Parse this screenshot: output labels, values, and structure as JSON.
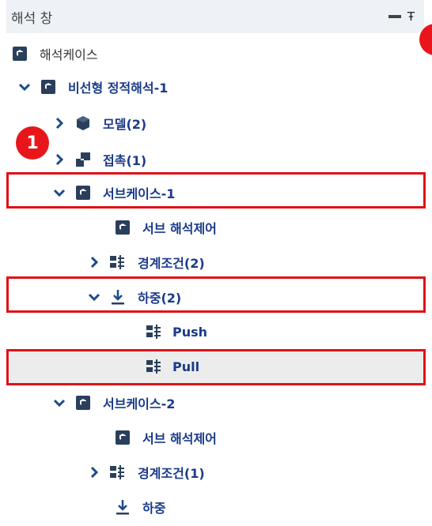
{
  "header": {
    "title": "해석 창",
    "minimize_icon": "minimize-icon",
    "pin_icon": "pin-icon",
    "pin_glyph": "Ŧ"
  },
  "badge": {
    "number": "1"
  },
  "tree": {
    "root": {
      "label": "해석케이스"
    },
    "case": {
      "label": "비선형 정적해석-1"
    },
    "model": {
      "label": "모델(2)"
    },
    "contact": {
      "label": "접촉(1)"
    },
    "subcase1": {
      "label": "서브케이스-1"
    },
    "subcase1_control": {
      "label": "서브 해석제어"
    },
    "subcase1_bc": {
      "label": "경계조건(2)"
    },
    "subcase1_load": {
      "label": "하중(2)"
    },
    "load_push": {
      "label": "Push"
    },
    "load_pull": {
      "label": "Pull"
    },
    "subcase2": {
      "label": "서브케이스-2"
    },
    "subcase2_control": {
      "label": "서브 해석제어"
    },
    "subcase2_bc": {
      "label": "경계조건(1)"
    },
    "subcase2_load": {
      "label": "하중"
    }
  },
  "colors": {
    "highlight": "#e01216",
    "text_blue": "#1a3a8a",
    "icon_dark": "#2a3f5c",
    "header_bg": "#eef1f6",
    "selection_bg": "#ececec"
  }
}
